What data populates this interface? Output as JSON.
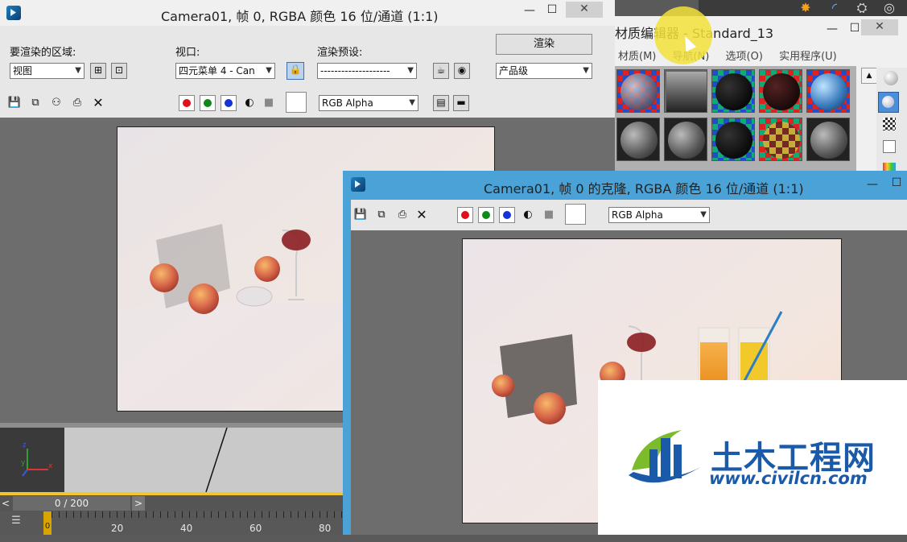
{
  "main_window": {
    "title": "Camera01, 帧 0, RGBA 颜色 16 位/通道 (1:1)",
    "minimize": "—",
    "maximize": "☐",
    "close": "✕",
    "area_label": "要渲染的区域:",
    "area_value": "视图",
    "viewport_label": "视口:",
    "viewport_value": "四元菜单 4 - Can",
    "preset_label": "渲染预设:",
    "preset_value": "--------------------",
    "render_button": "渲染",
    "production_value": "产品级",
    "channel_value": "RGB Alpha"
  },
  "material_editor": {
    "title": "材质编辑器 - Standard_13",
    "minimize": "—",
    "maximize": "☐",
    "close": "✕",
    "menus": [
      "材质(M)",
      "导航(N)",
      "选项(O)",
      "实用程序(U)"
    ]
  },
  "clone_window": {
    "title": "Camera01, 帧 0 的克隆, RGBA 颜色 16 位/通道 (1:1)",
    "minimize": "—",
    "maximize": "☐",
    "channel_value": "RGB Alpha"
  },
  "timeline": {
    "frame_counter": "0 / 200",
    "prev": "<",
    "next": ">",
    "tick_labels": [
      "20",
      "40",
      "60",
      "80"
    ],
    "current_marker": "0"
  },
  "viewport_axes": {
    "x": "x",
    "y": "y",
    "z": "z"
  },
  "watermark": {
    "brand": "土木工程网",
    "url": "www.civilcn.com"
  },
  "colors": {
    "red": "#e0101a",
    "green": "#0f8a19",
    "blue": "#1533d6",
    "accent_blue": "#4aa2d6",
    "highlight": "#f2e23a",
    "brand_blue": "#1a5aa8",
    "brand_green": "#7bbb2c"
  }
}
